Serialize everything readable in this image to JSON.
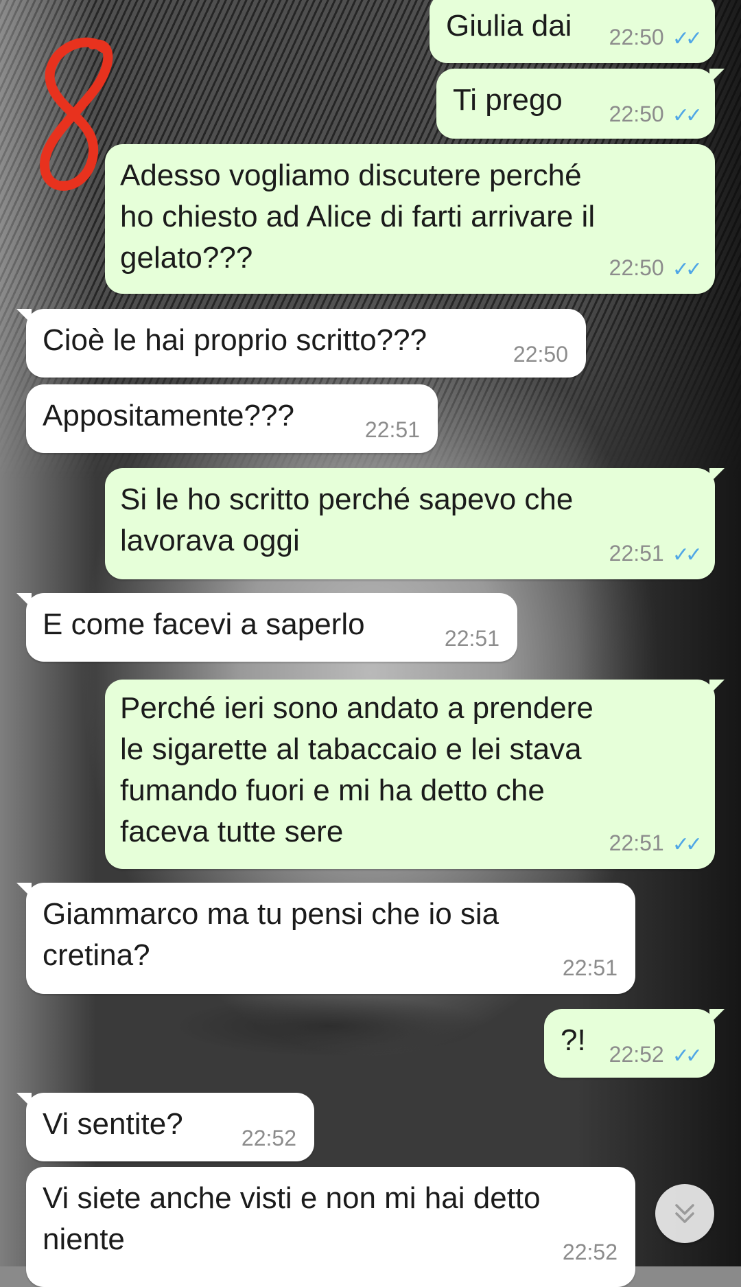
{
  "messages": [
    {
      "side": "out",
      "text": "Giulia dai",
      "time": "22:50",
      "status": "read"
    },
    {
      "side": "out",
      "text": "Ti prego",
      "time": "22:50",
      "status": "read"
    },
    {
      "side": "out",
      "text": "Adesso vogliamo discutere perché\nho chiesto ad Alice di farti arrivare il\ngelato???",
      "time": "22:50",
      "status": "read"
    },
    {
      "side": "in",
      "text": "Cioè le hai proprio scritto???",
      "time": "22:50"
    },
    {
      "side": "in",
      "text": "Appositamente???",
      "time": "22:51"
    },
    {
      "side": "out",
      "text": "Si le ho scritto perché sapevo che\nlavorava oggi",
      "time": "22:51",
      "status": "read"
    },
    {
      "side": "in",
      "text": "E come facevi a saperlo",
      "time": "22:51"
    },
    {
      "side": "out",
      "text": "Perché ieri sono andato a prendere\nle sigarette al tabaccaio e lei stava\nfumando fuori e mi ha detto che\nfaceva tutte sere",
      "time": "22:51",
      "status": "read"
    },
    {
      "side": "in",
      "text": "Giammarco ma tu pensi che io sia\ncretina?",
      "time": "22:51"
    },
    {
      "side": "out",
      "text": "?!",
      "time": "22:52",
      "status": "read"
    },
    {
      "side": "in",
      "text": "Vi sentite?",
      "time": "22:52"
    },
    {
      "side": "in",
      "text": "Vi siete anche visti e non mi hai detto\nniente",
      "time": "22:52"
    }
  ],
  "annotation": {
    "text": "8",
    "color": "#e8321e"
  },
  "colors": {
    "outgoing": "#e6ffd9",
    "incoming": "#ffffff",
    "read_ticks": "#4fa6e6",
    "time": "#8c8c8c"
  },
  "icons": {
    "read_status": "double-check-icon",
    "scroll_down": "chevron-double-down-icon"
  }
}
